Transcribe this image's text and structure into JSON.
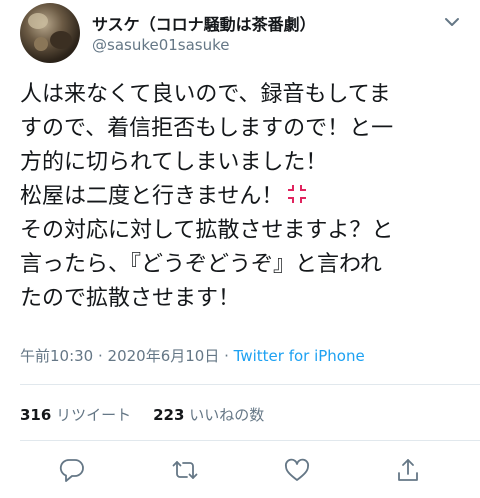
{
  "tweet": {
    "author": {
      "display_name": "サスケ（コロナ騒動は茶番劇）",
      "handle": "@sasuke01sasuke",
      "avatar_icon": "avatar-photo"
    },
    "text_lines": [
      "人は来なくて良いので、録音もしてま",
      "すので、着信拒否もしますので！と一",
      "方的に切られてしまいました！",
      "松屋は二度と行きません！",
      "その対応に対して拡散させますよ？と",
      "言ったら、『どうぞどうぞ』と言われ",
      "たので拡散させます！"
    ],
    "timestamp": "午前10:30 · 2020年6月10日 · ",
    "source": "Twitter for iPhone",
    "stats": {
      "retweets": "316",
      "retweets_label": "リツイート",
      "likes": "223",
      "likes_label": "いいねの数"
    }
  },
  "colors": {
    "text": "#14171a",
    "secondary": "#657786",
    "accent": "#1da1f2",
    "anger_emoji": "#e0245e"
  },
  "icons": [
    "chevron-down-icon",
    "anger-emoji-icon",
    "reply-icon",
    "retweet-icon",
    "like-icon",
    "share-icon"
  ]
}
